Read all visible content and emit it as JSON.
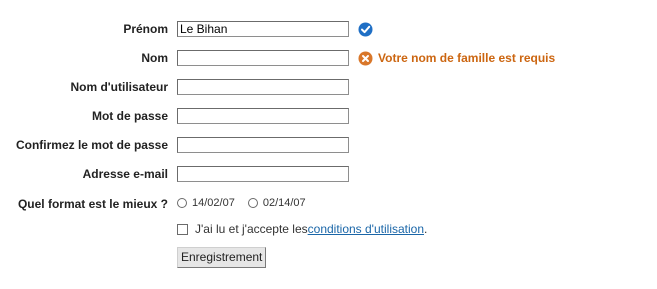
{
  "form": {
    "fields": [
      {
        "label": "Prénom",
        "value": "Le Bihan",
        "status": "valid"
      },
      {
        "label": "Nom",
        "value": "",
        "status": "error"
      },
      {
        "label": "Nom d'utilisateur",
        "value": ""
      },
      {
        "label": "Mot de passe",
        "value": ""
      },
      {
        "label": "Confirmez le mot de passe",
        "value": ""
      },
      {
        "label": "Adresse e-mail",
        "value": ""
      }
    ],
    "nom_error": "Votre nom de famille est requis",
    "date_format": {
      "label": "Quel format est le mieux ?",
      "options": [
        "14/02/07",
        "02/14/07"
      ]
    },
    "terms": {
      "text_before": "J'ai lu et j'accepte les ",
      "link_text": "conditions d'utilisation",
      "text_after": "."
    },
    "submit_label": "Enregistrement"
  },
  "colors": {
    "valid_icon": "#1f6fc5",
    "error_icon": "#d9772a",
    "error_text": "#cc6611",
    "link": "#1a66a8"
  },
  "icons": {
    "valid": "check-circle-icon",
    "error": "x-circle-icon"
  }
}
